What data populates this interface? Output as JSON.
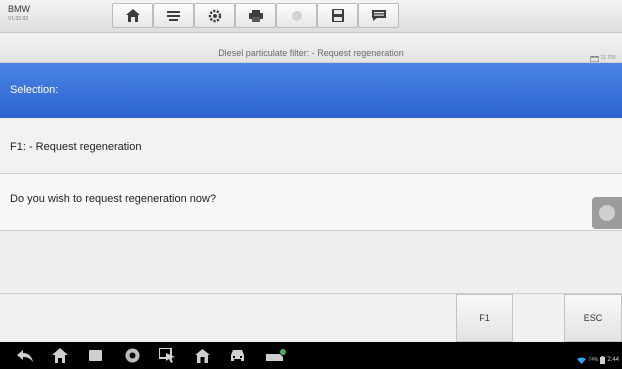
{
  "app": {
    "make": "BMW",
    "version": "V1.03.03"
  },
  "toolbar": {
    "buttons": [
      {
        "icon": "home-icon"
      },
      {
        "icon": "vehicle-swap-icon"
      },
      {
        "icon": "settings-gear-icon"
      },
      {
        "icon": "print-icon"
      },
      {
        "icon": "help-icon"
      },
      {
        "icon": "save-icon"
      },
      {
        "icon": "data-logging-icon"
      }
    ]
  },
  "header": {
    "title": "Diesel particulate filter: - Request regeneration",
    "voltage": "11.70V"
  },
  "selection": {
    "label": "Selection:"
  },
  "rows": {
    "function": "F1: - Request regeneration",
    "question": "Do you wish to request regeneration now?"
  },
  "actions": {
    "f1_label": "F1",
    "esc_label": "ESC"
  },
  "system_bar": {
    "battery": "74%",
    "time": "2:44"
  },
  "colors": {
    "selection_blue": "#3a72dc",
    "nav_black": "#000000"
  }
}
